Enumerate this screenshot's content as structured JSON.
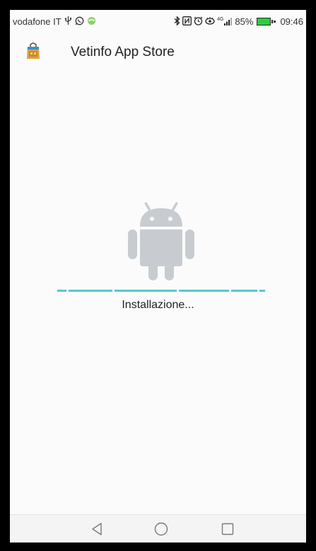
{
  "status_bar": {
    "carrier": "vodafone IT",
    "battery_percent": "85%",
    "time": "09:46",
    "signal_label": "4G",
    "icons_left": [
      "usb-icon",
      "whatsapp-icon",
      "app-notification-icon"
    ],
    "icons_right": [
      "bluetooth-icon",
      "nfc-icon",
      "alarm-icon",
      "eye-comfort-icon",
      "signal-icon",
      "battery-icon"
    ]
  },
  "app_bar": {
    "title": "Vetinfo App Store",
    "icon": "shopping-bag-icon"
  },
  "installer": {
    "status": "Installazione...",
    "robot_color": "#c8ccd0",
    "progress_color": "#5cc6cc",
    "progress": "indeterminate"
  },
  "nav_bar": {
    "buttons": [
      "back",
      "home",
      "recents"
    ]
  }
}
